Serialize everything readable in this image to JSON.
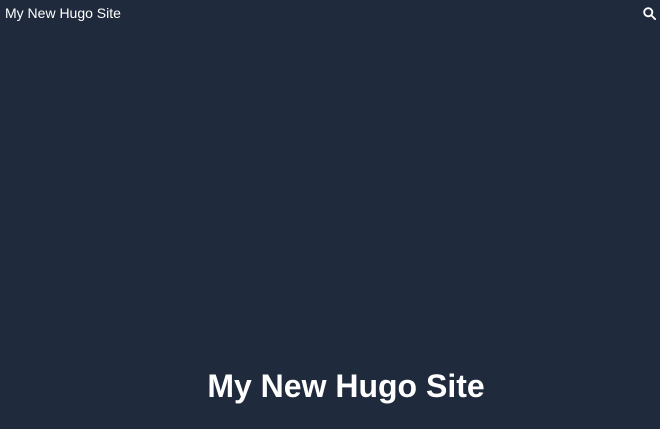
{
  "header": {
    "site_title": "My New Hugo Site",
    "search_icon": "search-icon"
  },
  "hero": {
    "title": "My New Hugo Site"
  },
  "colors": {
    "background": "#1f2a3d",
    "text": "#ffffff"
  }
}
